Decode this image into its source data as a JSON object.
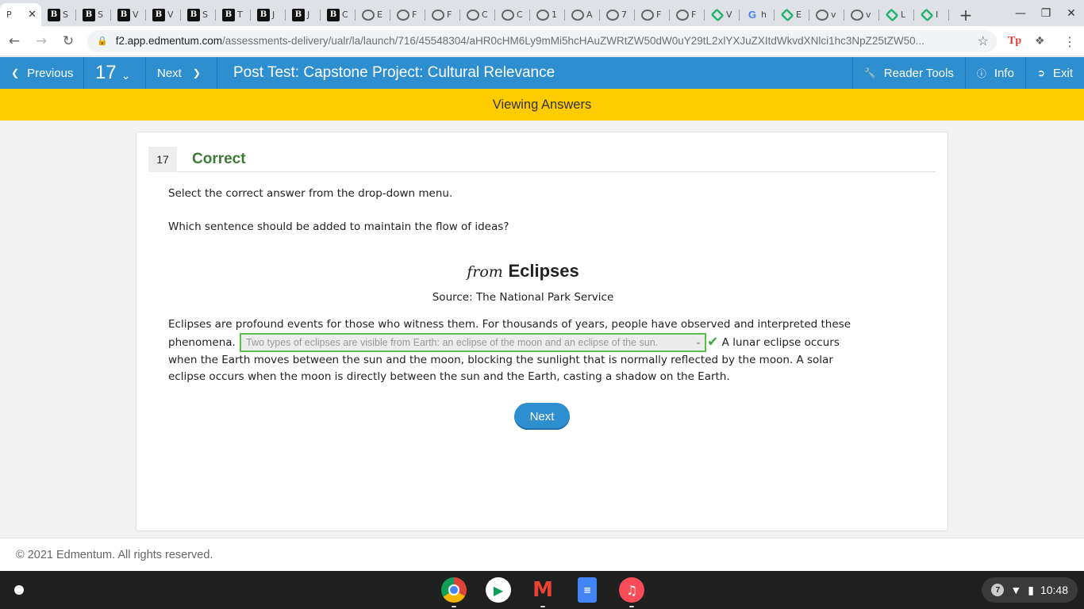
{
  "browser": {
    "tabs": [
      {
        "letter": "P",
        "icon": "page-icon",
        "kind": "b"
      },
      {
        "letter": "S",
        "icon": "brainly-icon",
        "kind": "b"
      },
      {
        "letter": "S",
        "icon": "brainly-icon",
        "kind": "b"
      },
      {
        "letter": "V",
        "icon": "brainly-icon",
        "kind": "b"
      },
      {
        "letter": "V",
        "icon": "brainly-icon",
        "kind": "b"
      },
      {
        "letter": "S",
        "icon": "brainly-icon",
        "kind": "b"
      },
      {
        "letter": "T",
        "icon": "brainly-icon",
        "kind": "b"
      },
      {
        "letter": "J",
        "icon": "brainly-icon",
        "kind": "b"
      },
      {
        "letter": "J",
        "icon": "brainly-icon",
        "kind": "b"
      },
      {
        "letter": "C",
        "icon": "brainly-icon",
        "kind": "b"
      },
      {
        "letter": "E",
        "icon": "globe-icon",
        "kind": "g"
      },
      {
        "letter": "F",
        "icon": "globe-icon",
        "kind": "g"
      },
      {
        "letter": "F",
        "icon": "globe-icon",
        "kind": "g"
      },
      {
        "letter": "C",
        "icon": "globe-icon",
        "kind": "g"
      },
      {
        "letter": "C",
        "icon": "globe-icon",
        "kind": "g"
      },
      {
        "letter": "1",
        "icon": "globe-icon",
        "kind": "g"
      },
      {
        "letter": "A",
        "icon": "globe-icon",
        "kind": "g"
      },
      {
        "letter": "7",
        "icon": "globe-icon",
        "kind": "g"
      },
      {
        "letter": "F",
        "icon": "globe-icon",
        "kind": "g"
      },
      {
        "letter": "F",
        "icon": "globe-icon",
        "kind": "g"
      },
      {
        "letter": "V",
        "icon": "edmentum-icon",
        "kind": "e"
      },
      {
        "letter": "h",
        "icon": "google-icon",
        "kind": "goog"
      },
      {
        "letter": "E",
        "icon": "edmentum-icon",
        "kind": "e"
      },
      {
        "letter": "v",
        "icon": "globe-icon",
        "kind": "g"
      },
      {
        "letter": "v",
        "icon": "globe-icon",
        "kind": "g"
      },
      {
        "letter": "L",
        "icon": "edmentum-icon",
        "kind": "e"
      },
      {
        "letter": "I",
        "icon": "edmentum-icon",
        "kind": "e"
      }
    ],
    "url_host": "f2.app.edmentum.com",
    "url_path": "/assessments-delivery/ualr/la/launch/716/45548304/aHR0cHM6Ly9mMi5hcHAuZWRtZW50dW0uY29tL2xlYXJuZXItdWkvdXNlci1hc3NpZ25tZW50..."
  },
  "header": {
    "previous_label": "Previous",
    "question_number": "17",
    "next_label": "Next",
    "title": "Post Test: Capstone Project: Cultural Relevance",
    "reader_tools_label": "Reader Tools",
    "info_label": "Info",
    "exit_label": "Exit"
  },
  "banner": {
    "text": "Viewing Answers"
  },
  "question": {
    "number": "17",
    "status": "Correct",
    "instruction": "Select the correct answer from the drop-down menu.",
    "prompt": "Which sentence should be added to maintain the flow of ideas?",
    "passage_from": "from",
    "passage_title": "Eclipses",
    "source": "Source: The National Park Service",
    "passage_before": "Eclipses are profound events for those who witness them. For thousands of years, people have observed and interpreted these phenomena.",
    "selected_answer": "Two types of eclipses are visible from Earth: an eclipse of the moon and an eclipse of the sun.",
    "passage_after": "A lunar eclipse occurs when the Earth moves between the sun and the moon, blocking the sunlight that is normally reflected by the moon. A solar eclipse occurs when the moon is directly between the sun and the Earth, casting a shadow on the Earth.",
    "next_button": "Next"
  },
  "footer": {
    "copyright": "© 2021 Edmentum. All rights reserved."
  },
  "shelf": {
    "notification_count": "7",
    "time": "10:48"
  },
  "colors": {
    "header_blue": "#2e8fd0",
    "banner_yellow": "#ffcc00",
    "correct_green": "#3c7a35",
    "dropdown_border": "#5bbd4d"
  }
}
